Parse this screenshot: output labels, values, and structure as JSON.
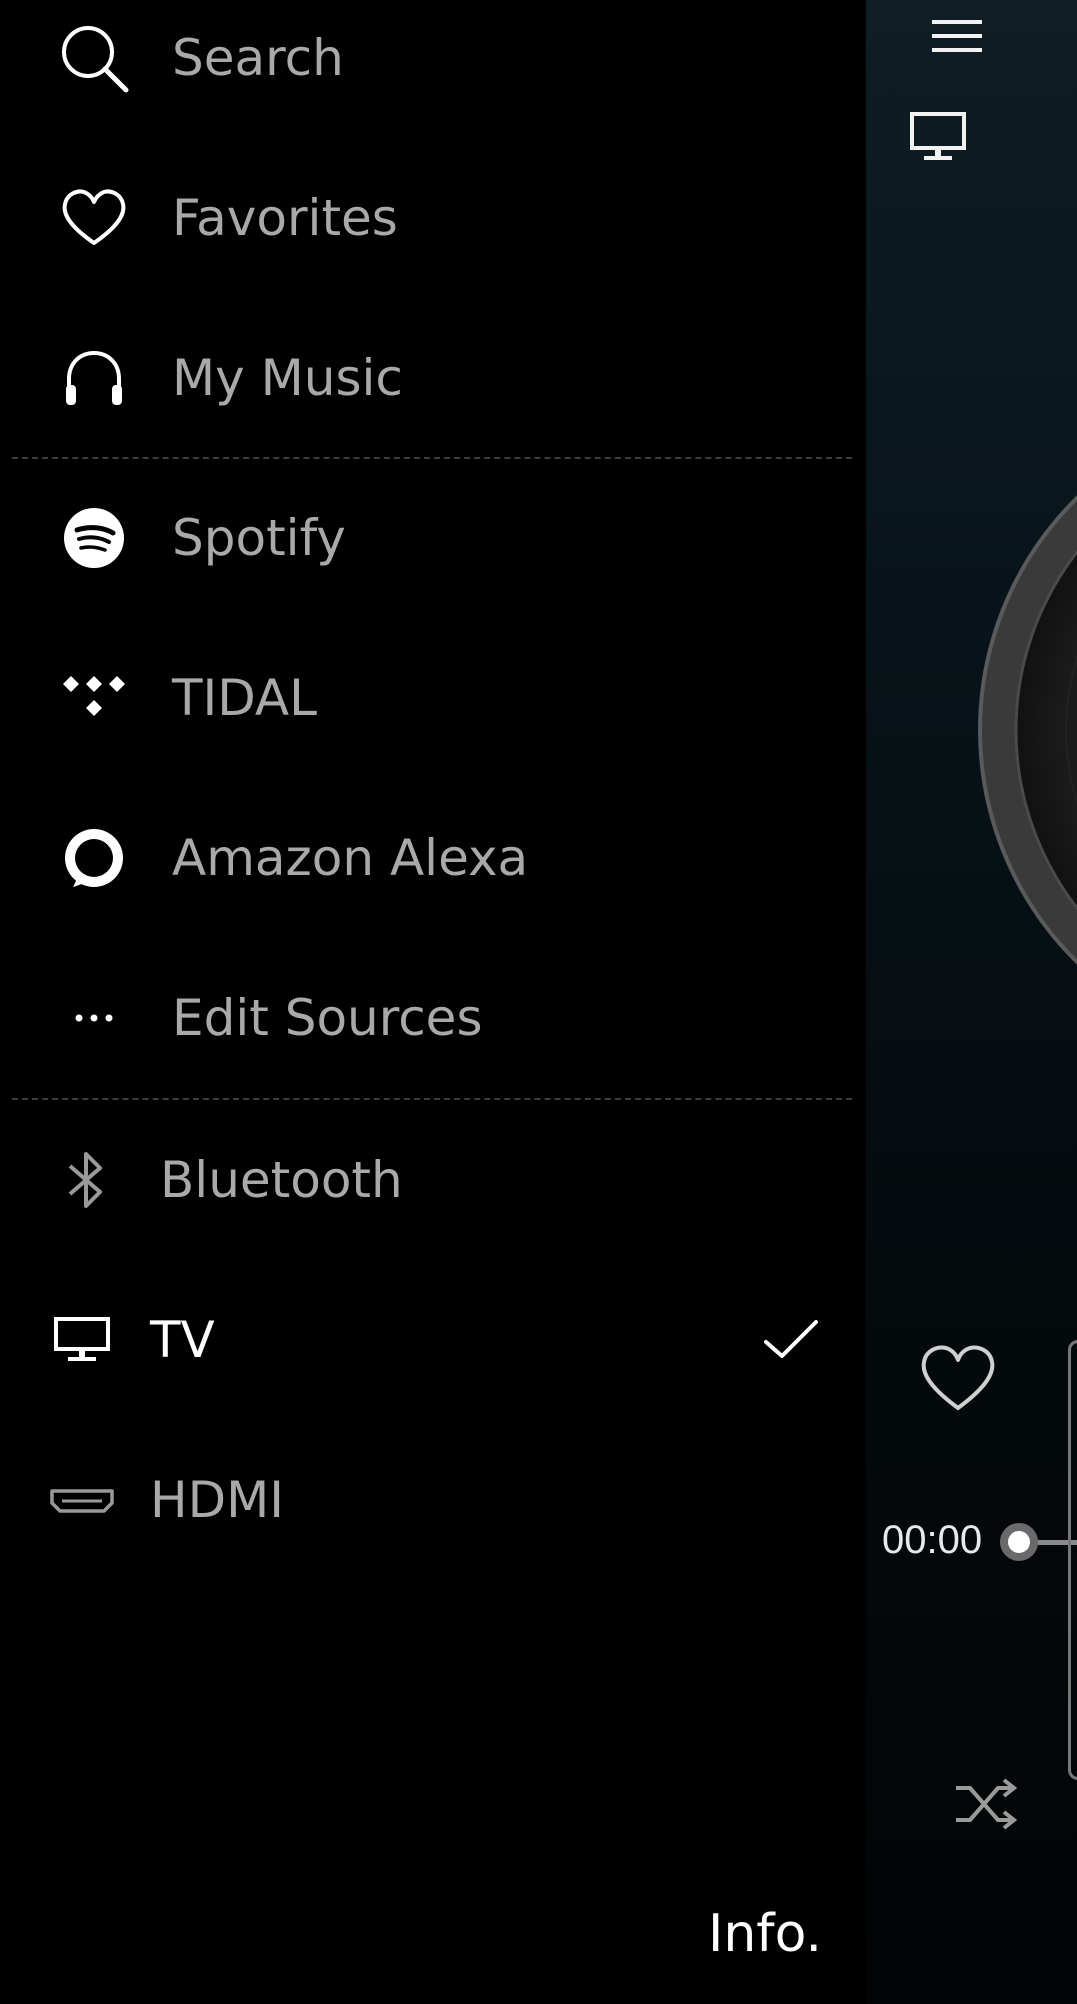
{
  "drawer": {
    "items": [
      {
        "label": "Search",
        "icon": "search-icon"
      },
      {
        "label": "Favorites",
        "icon": "heart-icon"
      },
      {
        "label": "My Music",
        "icon": "headphones-icon"
      },
      {
        "label": "Spotify",
        "icon": "spotify-icon"
      },
      {
        "label": "TIDAL",
        "icon": "tidal-icon"
      },
      {
        "label": "Amazon Alexa",
        "icon": "alexa-icon"
      },
      {
        "label": "Edit Sources",
        "icon": "more-dots-icon"
      },
      {
        "label": "Bluetooth",
        "icon": "bluetooth-icon"
      },
      {
        "label": "TV",
        "icon": "tv-icon",
        "selected": true
      },
      {
        "label": "HDMI",
        "icon": "hdmi-icon"
      }
    ],
    "info_label": "Info."
  },
  "player": {
    "elapsed_time": "00:00",
    "icons": [
      "menu-icon",
      "tv-icon",
      "heart-icon",
      "shuffle-icon"
    ]
  },
  "colors": {
    "background": "#000000",
    "label_inactive": "#a9a9a9",
    "label_active": "#ffffff",
    "divider": "#3d3d3d"
  }
}
